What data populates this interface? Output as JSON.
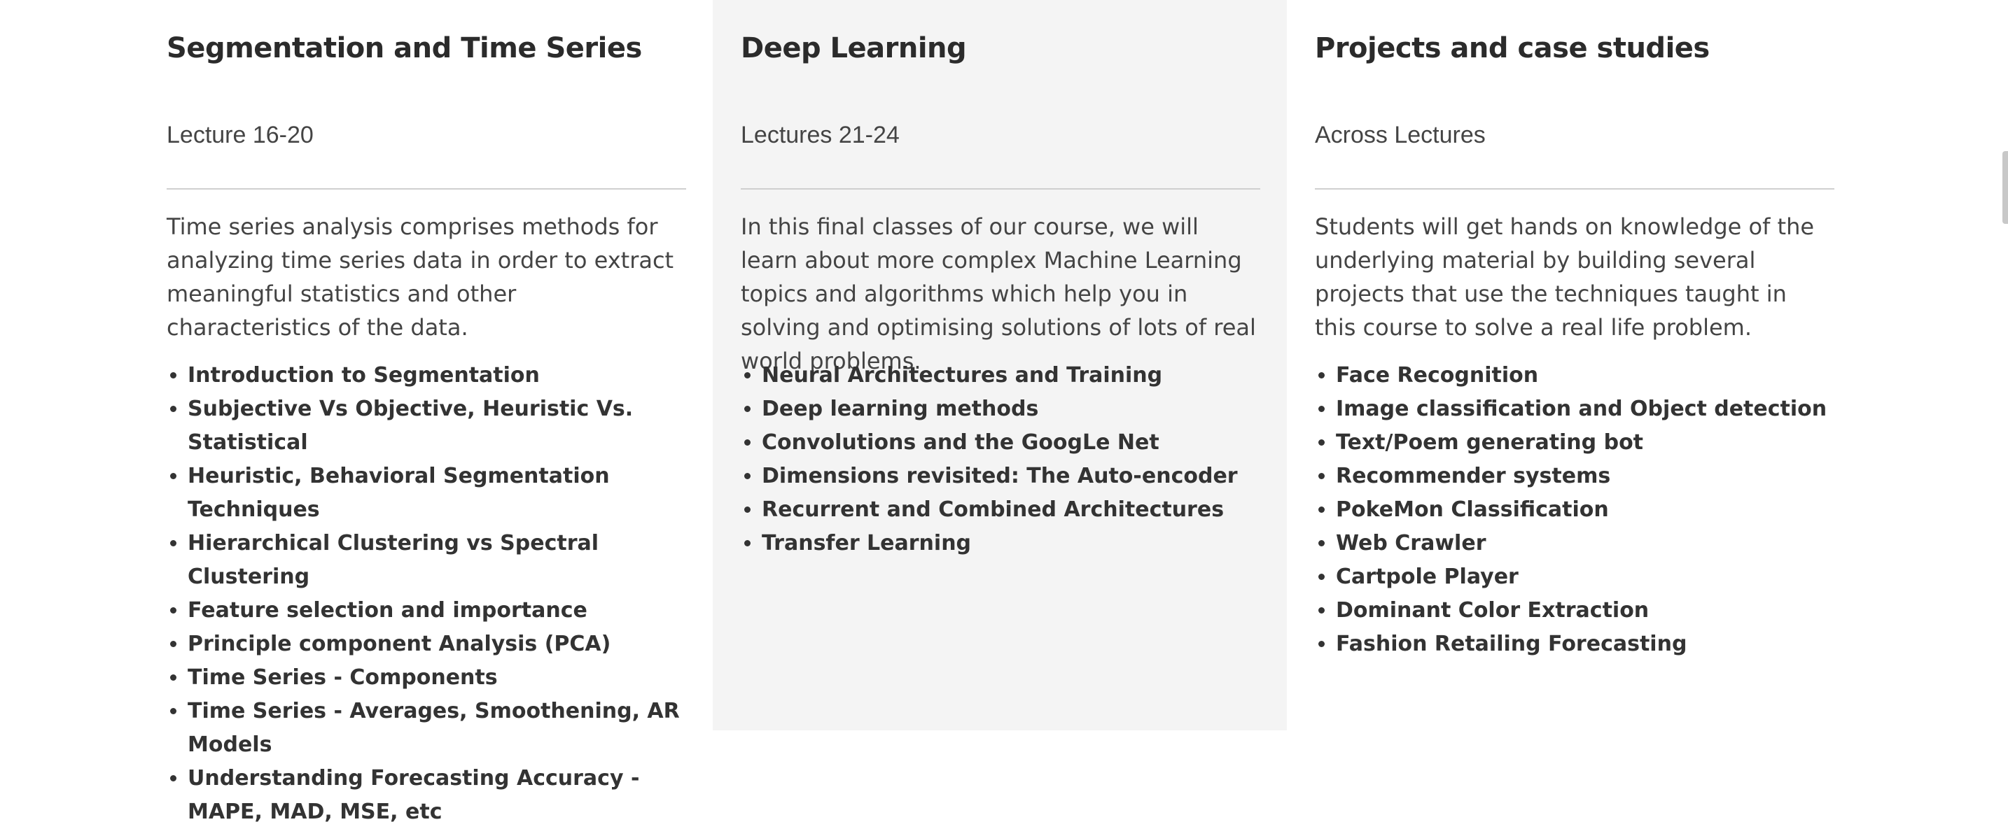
{
  "columns": [
    {
      "title": "Segmentation and Time Series",
      "subtitle": "Lecture 16-20",
      "description": "Time series analysis comprises methods for analyzing time series data in order to extract meaningful statistics and other characteristics of the data.",
      "topics": [
        "Introduction to Segmentation",
        "Subjective Vs Objective, Heuristic Vs. Statistical",
        "Heuristic, Behavioral Segmentation Techniques",
        "Hierarchical Clustering vs Spectral Clustering",
        "Feature selection and importance",
        "Principle component Analysis (PCA)",
        "Time Series - Components",
        "Time Series - Averages, Smoothening, AR Models",
        "Understanding Forecasting Accuracy - MAPE, MAD, MSE, etc"
      ]
    },
    {
      "title": "Deep Learning",
      "subtitle": "Lectures 21-24",
      "description": "In this final classes of our course, we will learn about more complex Machine Learning topics and algorithms which help you in solving and optimising solutions of lots of real world problems.",
      "topics": [
        "Neural Architectures and Training",
        "Deep learning methods",
        "Convolutions and the GoogLe Net",
        "Dimensions revisited: The Auto-encoder",
        "Recurrent and Combined Architectures",
        "Transfer Learning"
      ]
    },
    {
      "title": "Projects and case studies",
      "subtitle": "Across Lectures",
      "description": "Students will get hands on knowledge of the underlying material by building several projects that use the techniques taught in this course to solve a real life problem.",
      "topics": [
        "Face Recognition",
        "Image classification and Object detection",
        "Text/Poem generating bot",
        "Recommender systems",
        "PokeMon Classification",
        "Web Crawler",
        "Cartpole Player",
        "Dominant Color Extraction",
        "Fashion Retailing Forecasting"
      ]
    }
  ]
}
